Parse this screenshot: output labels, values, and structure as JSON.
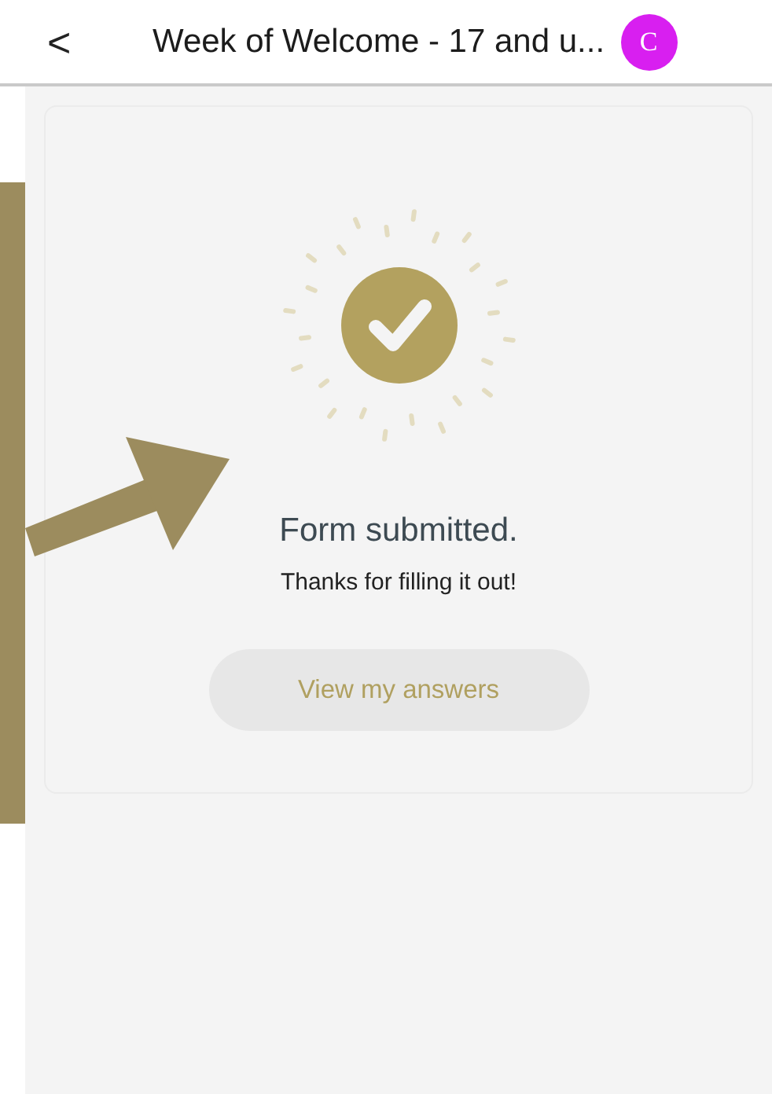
{
  "header": {
    "back_icon": "<",
    "title": "Week of Welcome - 17 and u...",
    "avatar_initial": "C"
  },
  "card": {
    "heading": "Form submitted.",
    "message": "Thanks for filling it out!",
    "button": "View my answers"
  }
}
